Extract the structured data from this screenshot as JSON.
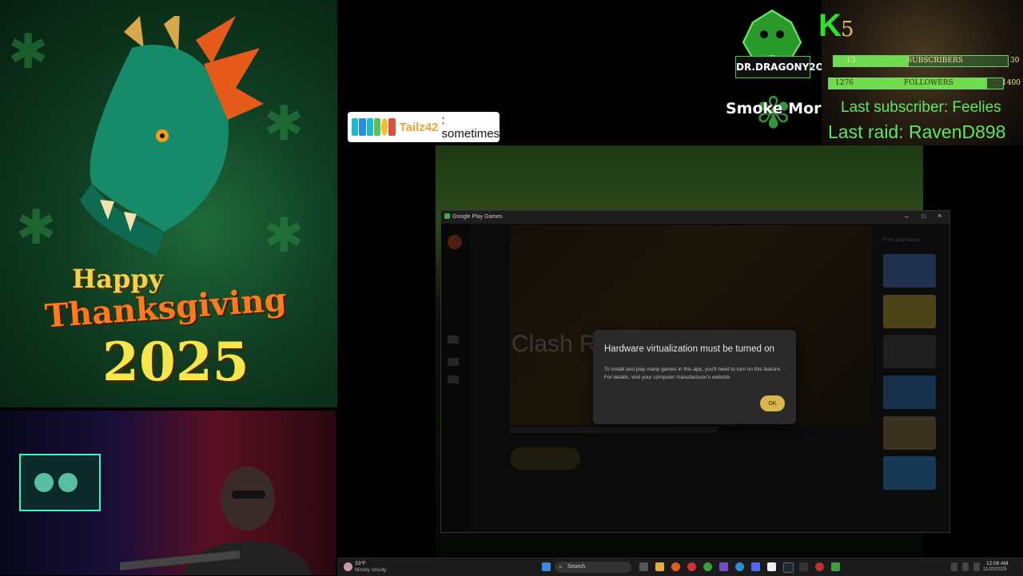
{
  "thanksgiving": {
    "happy": "Happy",
    "thanksgiving": "Thanksgiving",
    "year": "2025"
  },
  "chat": {
    "user": "Tailz42",
    "message": ": sometimes"
  },
  "overlay": {
    "logo_text": "DR.DRAGONY2O",
    "smoke_text": "Smoke More",
    "k_letter": "K",
    "k_number": "5",
    "subscribers": {
      "current": "13",
      "label": "SUBSCRIBERS",
      "goal": "30",
      "progress": 0.43
    },
    "followers": {
      "current": "1276",
      "label": "FOLLOWERS",
      "goal": "1400",
      "progress": 0.91
    },
    "last_subscriber": "Last subscriber: Feelies",
    "last_raid": "Last raid: RavenD898"
  },
  "window": {
    "title": "Google Play Games",
    "game_title": "Clash Ro",
    "rail_label": "From your library"
  },
  "dialog": {
    "title": "Hardware virtualization must be turned on",
    "body": "To install and play many games in this app, you'll need to turn on this feature. For details, visit your computer manufacturer's website.",
    "ok": "OK"
  },
  "taskbar": {
    "temperature": "33°F",
    "weather": "Mostly cloudy",
    "search": "Search",
    "time": "12:08 AM",
    "date": "11/20/2025"
  },
  "colors": {
    "accent_green": "#5fe85f",
    "ok_button": "#d9b54a",
    "dialog_bg": "#2a2a2a"
  }
}
